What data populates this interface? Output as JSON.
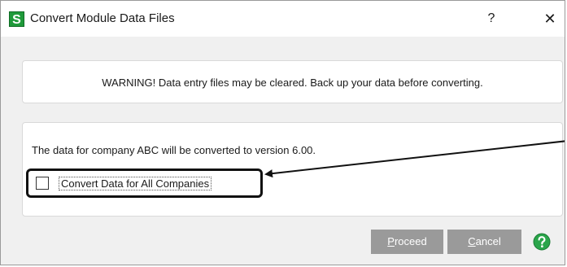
{
  "window": {
    "title": "Convert Module Data Files",
    "icon_letter": "S",
    "help_glyph": "?",
    "close_glyph": "✕"
  },
  "warning": {
    "text": "WARNING!  Data entry files may be cleared. Back up your data before converting."
  },
  "convert": {
    "info_text": "The data for company ABC will be converted to version 6.00.",
    "all_companies_label": "Convert Data for All Companies",
    "all_companies_checked": false
  },
  "buttons": {
    "proceed_hotkey": "P",
    "proceed_rest": "roceed",
    "cancel_hotkey": "C",
    "cancel_rest": "ancel"
  },
  "colors": {
    "app_icon": "#1f9a3a",
    "button_bg": "#9a9a9a",
    "help_icon": "#2aa54a"
  },
  "icons": {
    "app": "sage-s-icon",
    "help": "help-circle-icon",
    "close": "close-icon"
  }
}
